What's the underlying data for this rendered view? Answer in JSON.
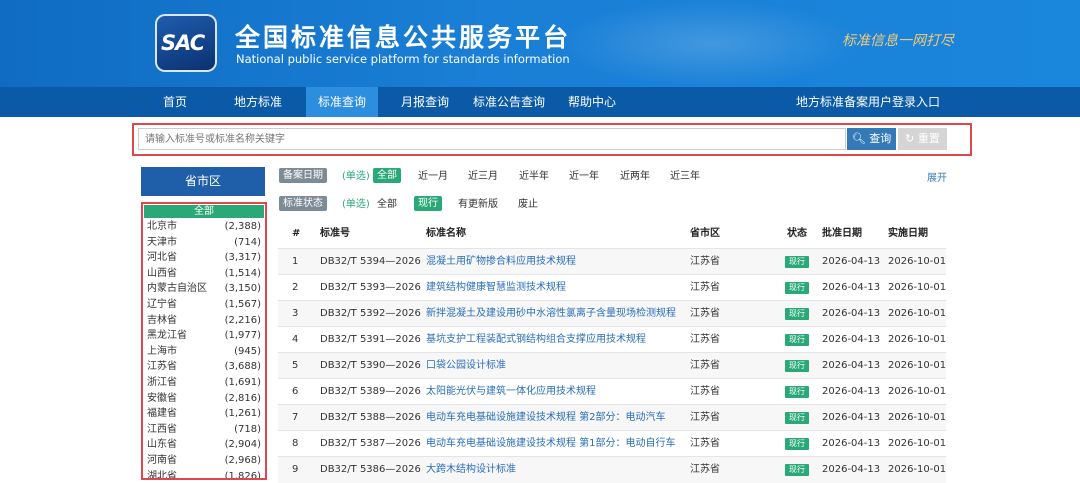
{
  "header": {
    "logo_text": "SAC",
    "title": "全国标准信息公共服务平台",
    "subtitle": "National public service platform  for standards information",
    "slogan": "标准信息一网打尽"
  },
  "nav": {
    "items": [
      "首页",
      "地方标准",
      "标准查询",
      "月报查询",
      "标准公告查询",
      "帮助中心"
    ],
    "active": "标准查询",
    "login": "地方标准备案用户登录入口"
  },
  "search": {
    "placeholder": "请输入标准号或标准名称关键字",
    "search_label": "查询",
    "reset_label": "重置"
  },
  "sidebar": {
    "title": "省市区",
    "all_label": "全部",
    "provinces": [
      {
        "name": "北京市",
        "count": "(2,388)"
      },
      {
        "name": "天津市",
        "count": "(714)"
      },
      {
        "name": "河北省",
        "count": "(3,317)"
      },
      {
        "name": "山西省",
        "count": "(1,514)"
      },
      {
        "name": "内蒙古自治区",
        "count": "(3,150)"
      },
      {
        "name": "辽宁省",
        "count": "(1,567)"
      },
      {
        "name": "吉林省",
        "count": "(2,216)"
      },
      {
        "name": "黑龙江省",
        "count": "(1,977)"
      },
      {
        "name": "上海市",
        "count": "(945)"
      },
      {
        "name": "江苏省",
        "count": "(3,688)"
      },
      {
        "name": "浙江省",
        "count": "(1,691)"
      },
      {
        "name": "安徽省",
        "count": "(2,816)"
      },
      {
        "name": "福建省",
        "count": "(1,261)"
      },
      {
        "name": "江西省",
        "count": "(718)"
      },
      {
        "name": "山东省",
        "count": "(2,904)"
      },
      {
        "name": "河南省",
        "count": "(2,968)"
      },
      {
        "name": "湖北省",
        "count": "(1,826)"
      }
    ]
  },
  "filters": {
    "date": {
      "label": "备案日期",
      "hint": "(单选)",
      "options": [
        "全部",
        "近一月",
        "近三月",
        "近半年",
        "近一年",
        "近两年",
        "近三年"
      ],
      "selected": "全部"
    },
    "status": {
      "label": "标准状态",
      "hint": "(单选)",
      "options": [
        "全部",
        "现行",
        "有更新版",
        "废止"
      ],
      "selected": "现行"
    },
    "expand_label": "展开"
  },
  "table": {
    "headers": [
      "#",
      "标准号",
      "标准名称",
      "省市区",
      "状态",
      "批准日期",
      "实施日期"
    ],
    "rows": [
      {
        "num": "1",
        "code": "DB32/T 5394—2026",
        "name": "混凝土用矿物掺合料应用技术规程",
        "region": "江苏省",
        "status": "现行",
        "approved": "2026-04-13",
        "effective": "2026-10-01"
      },
      {
        "num": "2",
        "code": "DB32/T 5393—2026",
        "name": "建筑结构健康智慧监测技术规程",
        "region": "江苏省",
        "status": "现行",
        "approved": "2026-04-13",
        "effective": "2026-10-01"
      },
      {
        "num": "3",
        "code": "DB32/T 5392—2026",
        "name": "新拌混凝土及建设用砂中水溶性氯离子含量现场检测规程",
        "region": "江苏省",
        "status": "现行",
        "approved": "2026-04-13",
        "effective": "2026-10-01"
      },
      {
        "num": "4",
        "code": "DB32/T 5391—2026",
        "name": "基坑支护工程装配式钢结构组合支撑应用技术规程",
        "region": "江苏省",
        "status": "现行",
        "approved": "2026-04-13",
        "effective": "2026-10-01"
      },
      {
        "num": "5",
        "code": "DB32/T 5390—2026",
        "name": "口袋公园设计标准",
        "region": "江苏省",
        "status": "现行",
        "approved": "2026-04-13",
        "effective": "2026-10-01"
      },
      {
        "num": "6",
        "code": "DB32/T 5389—2026",
        "name": "太阳能光伏与建筑一体化应用技术规程",
        "region": "江苏省",
        "status": "现行",
        "approved": "2026-04-13",
        "effective": "2026-10-01"
      },
      {
        "num": "7",
        "code": "DB32/T 5388—2026",
        "name": "电动车充电基础设施建设技术规程 第2部分：电动汽车",
        "region": "江苏省",
        "status": "现行",
        "approved": "2026-04-13",
        "effective": "2026-10-01"
      },
      {
        "num": "8",
        "code": "DB32/T 5387—2026",
        "name": "电动车充电基础设施建设技术规程 第1部分：电动自行车",
        "region": "江苏省",
        "status": "现行",
        "approved": "2026-04-13",
        "effective": "2026-10-01"
      },
      {
        "num": "9",
        "code": "DB32/T 5386—2026",
        "name": "大跨木结构设计标准",
        "region": "江苏省",
        "status": "现行",
        "approved": "2026-04-13",
        "effective": "2026-10-01"
      }
    ]
  }
}
